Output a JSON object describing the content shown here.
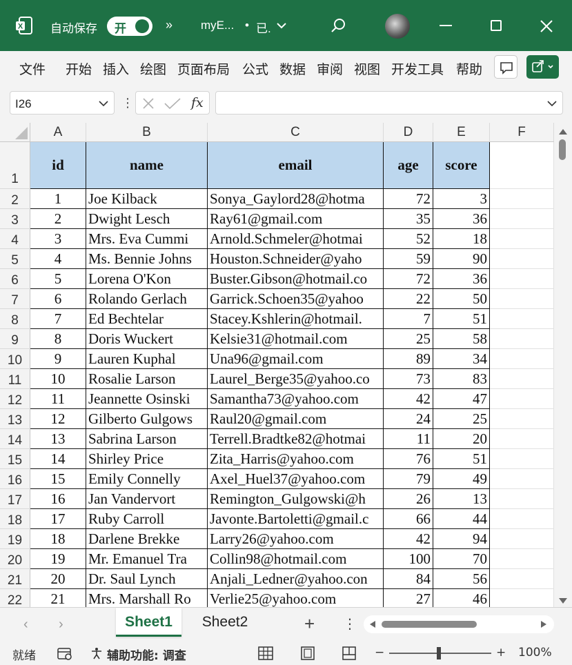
{
  "titlebar": {
    "autosave_label": "自动保存",
    "autosave_state": "开",
    "more": "»",
    "filename": "myE...",
    "modified_dot": "•",
    "saved_status": "已.",
    "icons": [
      "excel-app-icon",
      "search-icon",
      "avatar",
      "minimize-icon",
      "maximize-icon",
      "close-icon"
    ]
  },
  "ribbon": {
    "tabs": [
      "文件",
      "开始",
      "插入",
      "绘图",
      "页面布局",
      "公式",
      "数据",
      "审阅",
      "视图",
      "开发工具",
      "帮助"
    ]
  },
  "formula_bar": {
    "name_box": "I26",
    "sep": "⋮",
    "fx": "fx",
    "formula": ""
  },
  "grid": {
    "columns": [
      "A",
      "B",
      "C",
      "D",
      "E",
      "F"
    ],
    "headers": [
      "id",
      "name",
      "email",
      "age",
      "score"
    ],
    "header_row_num": "1",
    "rows": [
      {
        "num": "2",
        "id": "1",
        "name": "Joe Kilback",
        "email": "Sonya_Gaylord28@hotma",
        "age": "72",
        "score": "3"
      },
      {
        "num": "3",
        "id": "2",
        "name": "Dwight Lesch",
        "email": "Ray61@gmail.com",
        "age": "35",
        "score": "36"
      },
      {
        "num": "4",
        "id": "3",
        "name": "Mrs. Eva Cummi",
        "email": "Arnold.Schmeler@hotmai",
        "age": "52",
        "score": "18"
      },
      {
        "num": "5",
        "id": "4",
        "name": "Ms. Bennie Johns",
        "email": "Houston.Schneider@yaho",
        "age": "59",
        "score": "90"
      },
      {
        "num": "6",
        "id": "5",
        "name": "Lorena O'Kon",
        "email": "Buster.Gibson@hotmail.co",
        "age": "72",
        "score": "36"
      },
      {
        "num": "7",
        "id": "6",
        "name": "Rolando Gerlach",
        "email": "Garrick.Schoen35@yahoo",
        "age": "22",
        "score": "50"
      },
      {
        "num": "8",
        "id": "7",
        "name": "Ed Bechtelar",
        "email": "Stacey.Kshlerin@hotmail.",
        "age": "7",
        "score": "51"
      },
      {
        "num": "9",
        "id": "8",
        "name": "Doris Wuckert",
        "email": "Kelsie31@hotmail.com",
        "age": "25",
        "score": "58"
      },
      {
        "num": "10",
        "id": "9",
        "name": "Lauren Kuphal",
        "email": "Una96@gmail.com",
        "age": "89",
        "score": "34"
      },
      {
        "num": "11",
        "id": "10",
        "name": "Rosalie Larson",
        "email": "Laurel_Berge35@yahoo.co",
        "age": "73",
        "score": "83"
      },
      {
        "num": "12",
        "id": "11",
        "name": "Jeannette Osinski",
        "email": "Samantha73@yahoo.com",
        "age": "42",
        "score": "47"
      },
      {
        "num": "13",
        "id": "12",
        "name": "Gilberto Gulgows",
        "email": "Raul20@gmail.com",
        "age": "24",
        "score": "25"
      },
      {
        "num": "14",
        "id": "13",
        "name": "Sabrina Larson",
        "email": "Terrell.Bradtke82@hotmai",
        "age": "11",
        "score": "20"
      },
      {
        "num": "15",
        "id": "14",
        "name": "Shirley Price",
        "email": "Zita_Harris@yahoo.com",
        "age": "76",
        "score": "51"
      },
      {
        "num": "16",
        "id": "15",
        "name": "Emily Connelly",
        "email": "Axel_Huel37@yahoo.com",
        "age": "79",
        "score": "49"
      },
      {
        "num": "17",
        "id": "16",
        "name": "Jan Vandervort",
        "email": "Remington_Gulgowski@h",
        "age": "26",
        "score": "13"
      },
      {
        "num": "18",
        "id": "17",
        "name": "Ruby Carroll",
        "email": "Javonte.Bartoletti@gmail.c",
        "age": "66",
        "score": "44"
      },
      {
        "num": "19",
        "id": "18",
        "name": "Darlene Brekke",
        "email": "Larry26@yahoo.com",
        "age": "42",
        "score": "94"
      },
      {
        "num": "20",
        "id": "19",
        "name": "Mr. Emanuel Tra",
        "email": "Collin98@hotmail.com",
        "age": "100",
        "score": "70"
      },
      {
        "num": "21",
        "id": "20",
        "name": "Dr. Saul Lynch",
        "email": "Anjali_Ledner@yahoo.con",
        "age": "84",
        "score": "56"
      },
      {
        "num": "22",
        "id": "21",
        "name": "Mrs. Marshall Ro",
        "email": "Verlie25@yahoo.com",
        "age": "27",
        "score": "46"
      }
    ]
  },
  "sheets": {
    "tabs": [
      "Sheet1",
      "Sheet2"
    ],
    "active": "Sheet1",
    "add": "+",
    "options": "⋮"
  },
  "statusbar": {
    "ready": "就绪",
    "accessibility": "辅助功能: 调查",
    "zoom_minus": "−",
    "zoom_plus": "+",
    "zoom": "100%"
  },
  "colors": {
    "brand": "#1e7145",
    "header_fill": "#bdd7ee"
  }
}
